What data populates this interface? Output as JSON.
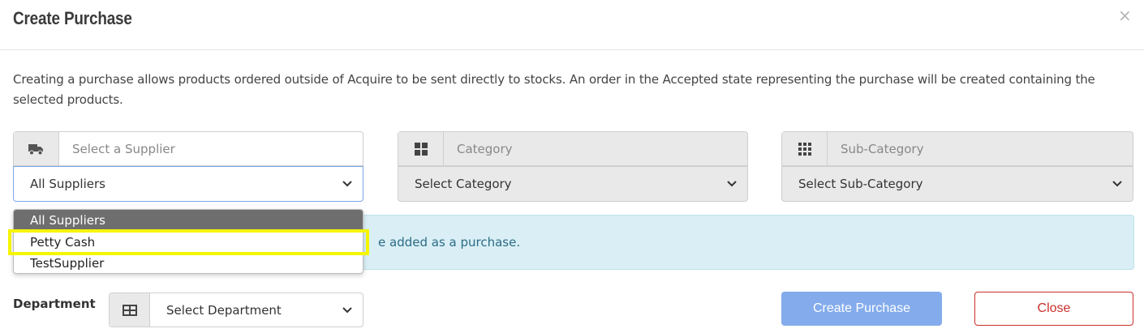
{
  "modal": {
    "title": "Create Purchase",
    "close_glyph": "×"
  },
  "description": "Creating a purchase allows products ordered outside of Acquire to be sent directly to stocks. An order in the Accepted state representing the purchase will be created containing the selected products.",
  "supplier": {
    "icon": "truck-icon",
    "placeholder": "Select a Supplier",
    "selected": "All Suppliers",
    "options": [
      "All Suppliers",
      "Petty Cash",
      "TestSupplier"
    ],
    "hovered_option": "All Suppliers",
    "highlighted_option": "Petty Cash"
  },
  "category": {
    "icon": "grid-icon",
    "placeholder": "Category",
    "selected": "Select Category"
  },
  "subcategory": {
    "icon": "grid-dots-icon",
    "placeholder": "Sub-Category",
    "selected": "Select Sub-Category"
  },
  "alert": {
    "visible_text": "e added as a purchase."
  },
  "department": {
    "label": "Department",
    "icon": "table-icon",
    "selected": "Select Department"
  },
  "buttons": {
    "create": "Create Purchase",
    "close": "Close"
  },
  "colors": {
    "primary_button": "#84acec",
    "danger": "#c9302c",
    "highlight": "#f5f500",
    "alert_bg": "#d9eff5"
  }
}
